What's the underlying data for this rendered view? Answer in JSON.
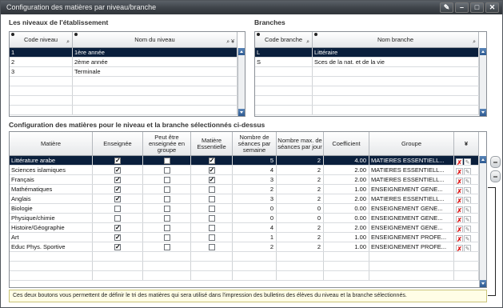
{
  "window": {
    "title": "Configuration des matières par niveau/branche"
  },
  "titlebar_buttons": [
    "brush-icon",
    "minimize-icon",
    "maximize-icon",
    "close-icon"
  ],
  "niveaux": {
    "section_title": "Les niveaux de l'établissement",
    "columns": [
      "Code niveau",
      "Nom du niveau"
    ],
    "rows": [
      {
        "code": "1",
        "nom": "1ère année"
      },
      {
        "code": "2",
        "nom": "2ème année"
      },
      {
        "code": "3",
        "nom": "Terminale"
      }
    ]
  },
  "branches": {
    "section_title": "Branches",
    "columns": [
      "Code branche",
      "Nom branche"
    ],
    "rows": [
      {
        "code": "L",
        "nom": "Littéraire"
      },
      {
        "code": "S",
        "nom": "Sces de la nat. et de la vie"
      }
    ]
  },
  "matieres": {
    "section_title": "Configuration des matières pour le niveau et la branche sélectionnés ci-dessus",
    "columns": [
      "Matière",
      "Enseignée",
      "Peut être enseignée en groupe",
      "Matière Essentielle",
      "Nombre de séances par semaine",
      "Nombre max. de séances par jour",
      "Coefficient",
      "Groupe"
    ],
    "rows": [
      {
        "matiere": "Littérature arabe",
        "enseignee": true,
        "groupe_ok": false,
        "essentielle": true,
        "seances_sem": "5",
        "max_jour": "2",
        "coef": "4.00",
        "groupe": "MATIERES ESSENTIELL..."
      },
      {
        "matiere": "Sciences islamiques",
        "enseignee": true,
        "groupe_ok": false,
        "essentielle": true,
        "seances_sem": "4",
        "max_jour": "2",
        "coef": "2.00",
        "groupe": "MATIERES ESSENTIELL..."
      },
      {
        "matiere": "Français",
        "enseignee": true,
        "groupe_ok": false,
        "essentielle": true,
        "seances_sem": "3",
        "max_jour": "2",
        "coef": "2.00",
        "groupe": "MATIERES ESSENTIELL..."
      },
      {
        "matiere": "Mathématiques",
        "enseignee": true,
        "groupe_ok": false,
        "essentielle": false,
        "seances_sem": "2",
        "max_jour": "2",
        "coef": "1.00",
        "groupe": "ENSEIGNEMENT GENE..."
      },
      {
        "matiere": "Anglais",
        "enseignee": true,
        "groupe_ok": false,
        "essentielle": false,
        "seances_sem": "3",
        "max_jour": "2",
        "coef": "2.00",
        "groupe": "MATIERES ESSENTIELL..."
      },
      {
        "matiere": "Biologie",
        "enseignee": false,
        "groupe_ok": false,
        "essentielle": false,
        "seances_sem": "0",
        "max_jour": "0",
        "coef": "0.00",
        "groupe": "ENSEIGNEMENT GENE..."
      },
      {
        "matiere": "Physique/chimie",
        "enseignee": false,
        "groupe_ok": false,
        "essentielle": false,
        "seances_sem": "0",
        "max_jour": "0",
        "coef": "0.00",
        "groupe": "ENSEIGNEMENT GENE..."
      },
      {
        "matiere": "Histoire/Géographie",
        "enseignee": true,
        "groupe_ok": false,
        "essentielle": false,
        "seances_sem": "4",
        "max_jour": "2",
        "coef": "2.00",
        "groupe": "ENSEIGNEMENT GENE..."
      },
      {
        "matiere": "Art",
        "enseignee": true,
        "groupe_ok": false,
        "essentielle": false,
        "seances_sem": "1",
        "max_jour": "2",
        "coef": "1.00",
        "groupe": "ENSEIGNEMENT PROFE..."
      },
      {
        "matiere": "Educ Phys. Sportive",
        "enseignee": true,
        "groupe_ok": false,
        "essentielle": false,
        "seances_sem": "2",
        "max_jour": "2",
        "coef": "1.00",
        "groupe": "ENSEIGNEMENT PROFE..."
      }
    ]
  },
  "note": "Ces deux boutons vous permettent de définir le tri des matières qui sera utilisé dans l'impression des bulletins des élèves du niveau et la branche sélectionnés."
}
